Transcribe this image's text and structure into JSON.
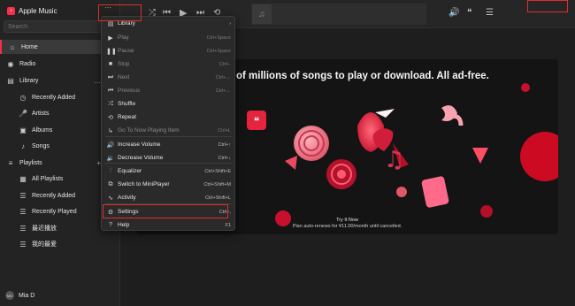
{
  "app": {
    "title": "Apple Music",
    "logo_glyph": "♪",
    "brand_color": "#fa2d48"
  },
  "sidebar": {
    "search_placeholder": "Search",
    "items": [
      {
        "label": "Home",
        "icon": "house-icon",
        "glyph": "⌂",
        "active": true
      },
      {
        "label": "Radio",
        "icon": "radio-icon",
        "glyph": "◉",
        "active": false
      },
      {
        "label": "Library",
        "icon": "library-icon",
        "glyph": "▤",
        "active": false,
        "trailing": "…"
      },
      {
        "label": "Recently Added",
        "icon": "clock-icon",
        "glyph": "◷",
        "active": false
      },
      {
        "label": "Artists",
        "icon": "microphone-icon",
        "glyph": "🎤",
        "active": false
      },
      {
        "label": "Albums",
        "icon": "album-icon",
        "glyph": "▣",
        "active": false
      },
      {
        "label": "Songs",
        "icon": "note-icon",
        "glyph": "♪",
        "active": false
      },
      {
        "label": "Playlists",
        "icon": "playlist-icon",
        "glyph": "≡",
        "active": false,
        "trailing": "+"
      },
      {
        "label": "All Playlists",
        "icon": "grid-icon",
        "glyph": "▦",
        "active": false
      },
      {
        "label": "Recently Added",
        "icon": "playlist-item-icon",
        "glyph": "☰",
        "active": false
      },
      {
        "label": "Recently Played",
        "icon": "playlist-item-icon",
        "glyph": "☰",
        "active": false
      },
      {
        "label": "最近播放",
        "icon": "playlist-item-icon",
        "glyph": "☰",
        "active": false
      },
      {
        "label": "我的最爱",
        "icon": "playlist-item-icon",
        "glyph": "☰",
        "active": false
      }
    ],
    "user": {
      "initials": "MD",
      "name": "Mia D"
    }
  },
  "toolbar": {
    "menu_button": "···",
    "shuffle": "⤮",
    "previous": "⏮",
    "play": "▶",
    "next": "⏭",
    "repeat": "⟲",
    "art_glyph": "♫",
    "apple_glyph": "",
    "volume": "🔊",
    "lyrics": "❝",
    "queue": "☰"
  },
  "menu": {
    "items": [
      {
        "label": "Library",
        "icon": "library-icon",
        "glyph": "▤",
        "shortcut": "›",
        "disabled": false
      },
      {
        "label": "Play",
        "icon": "play-icon",
        "glyph": "▶",
        "shortcut": "Ctrl+Space",
        "disabled": true
      },
      {
        "label": "Pause",
        "icon": "pause-icon",
        "glyph": "❚❚",
        "shortcut": "Ctrl+Space",
        "disabled": true
      },
      {
        "label": "Stop",
        "icon": "stop-icon",
        "glyph": "■",
        "shortcut": "Ctrl+.",
        "disabled": true
      },
      {
        "label": "Next",
        "icon": "next-icon",
        "glyph": "⏭",
        "shortcut": "Ctrl+→",
        "disabled": true
      },
      {
        "label": "Previous",
        "icon": "previous-icon",
        "glyph": "⏮",
        "shortcut": "Ctrl+←",
        "disabled": true
      },
      {
        "label": "Shuffle",
        "icon": "shuffle-icon",
        "glyph": "⤮",
        "shortcut": "",
        "disabled": false
      },
      {
        "label": "Repeat",
        "icon": "repeat-icon",
        "glyph": "⟲",
        "shortcut": "",
        "disabled": false
      },
      {
        "label": "Go To Now Playing Item",
        "icon": "goto-icon",
        "glyph": "↳",
        "shortcut": "Ctrl+L",
        "disabled": true
      },
      {
        "label": "Increase Volume",
        "icon": "volume-up-icon",
        "glyph": "🔊",
        "shortcut": "Ctrl+↑",
        "disabled": false
      },
      {
        "label": "Decrease Volume",
        "icon": "volume-down-icon",
        "glyph": "🔉",
        "shortcut": "Ctrl+↓",
        "disabled": false
      },
      {
        "label": "Equalizer",
        "icon": "equalizer-icon",
        "glyph": "⫶",
        "shortcut": "Ctrl+Shift+E",
        "disabled": false
      },
      {
        "label": "Switch to MiniPlayer",
        "icon": "miniplayer-icon",
        "glyph": "⧉",
        "shortcut": "Ctrl+Shift+M",
        "disabled": false
      },
      {
        "label": "Activity",
        "icon": "activity-icon",
        "glyph": "∿",
        "shortcut": "Ctrl+Shift+L",
        "disabled": false
      },
      {
        "label": "Settings",
        "icon": "gear-icon",
        "glyph": "⚙",
        "shortcut": "Ctrl+,",
        "disabled": false
      },
      {
        "label": "Help",
        "icon": "help-icon",
        "glyph": "?",
        "shortcut": "F1",
        "disabled": false
      }
    ]
  },
  "banner": {
    "heading": "of millions of songs to play or download. All ad-free.",
    "cta": "Try It Now",
    "subtext": "Plan auto-renews for ¥11.00/month until cancelled."
  },
  "colors": {
    "highlight_box": "#e02d2d",
    "accent": "#fa2d48"
  }
}
